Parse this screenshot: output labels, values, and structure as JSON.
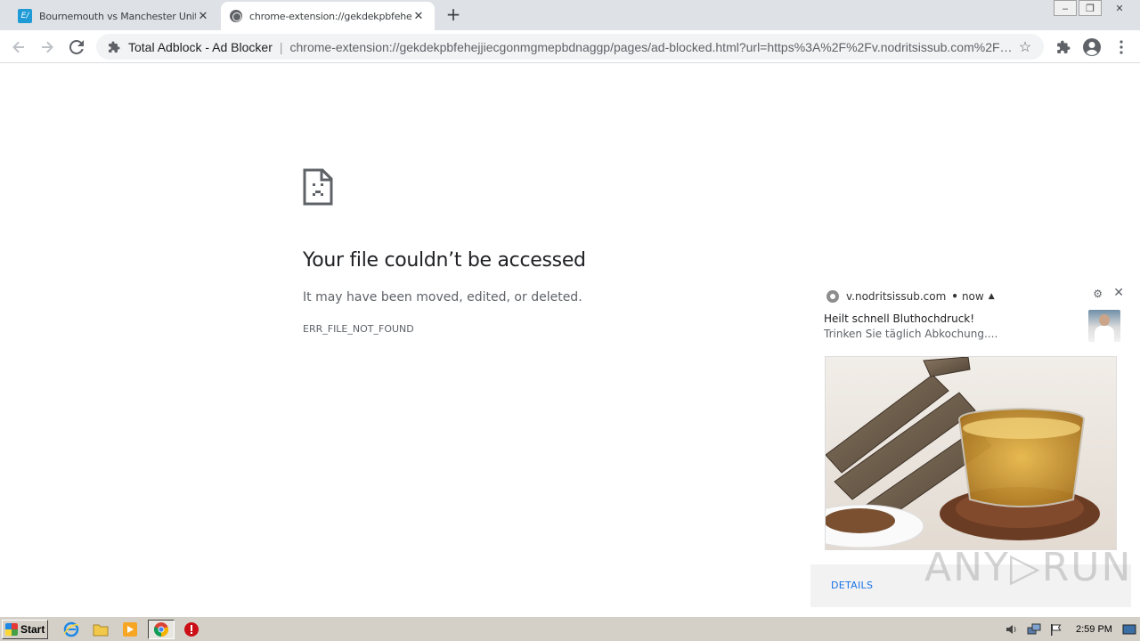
{
  "tabs": [
    {
      "title": "Bournemouth vs Manchester United Live"
    },
    {
      "title": "chrome-extension://gekdekpbfehejjiecgonmgmepbdnaggp"
    }
  ],
  "window_controls": {
    "minimize": "‒",
    "restore": "❐",
    "close": "✕"
  },
  "toolbar": {
    "extension_name": "Total Adblock - Ad Blocker",
    "separator": "|",
    "url": "chrome-extension://gekdekpbfehejjiecgonmgmepbdnaggp/pages/ad-blocked.html?url=https%3A%2F%2Fv.nodritsissub.com%2F…"
  },
  "error_page": {
    "title": "Your file couldn’t be accessed",
    "description": "It may have been moved, edited, or deleted.",
    "code": "ERR_FILE_NOT_FOUND"
  },
  "notification": {
    "origin": "v.nodritsissub.com",
    "time": "now",
    "title": "Heilt schnell Bluthochdruck!",
    "body": "Trinken Sie täglich Abkochung....",
    "action": "DETAILS"
  },
  "watermark": "ANY▷RUN",
  "taskbar": {
    "start_label": "Start",
    "clock": "2:59 PM"
  },
  "colors": {
    "tabstrip": "#dee1e6",
    "omnibox": "#f1f3f4",
    "link_blue": "#1a73e8",
    "taskbar": "#d4d0c8"
  }
}
